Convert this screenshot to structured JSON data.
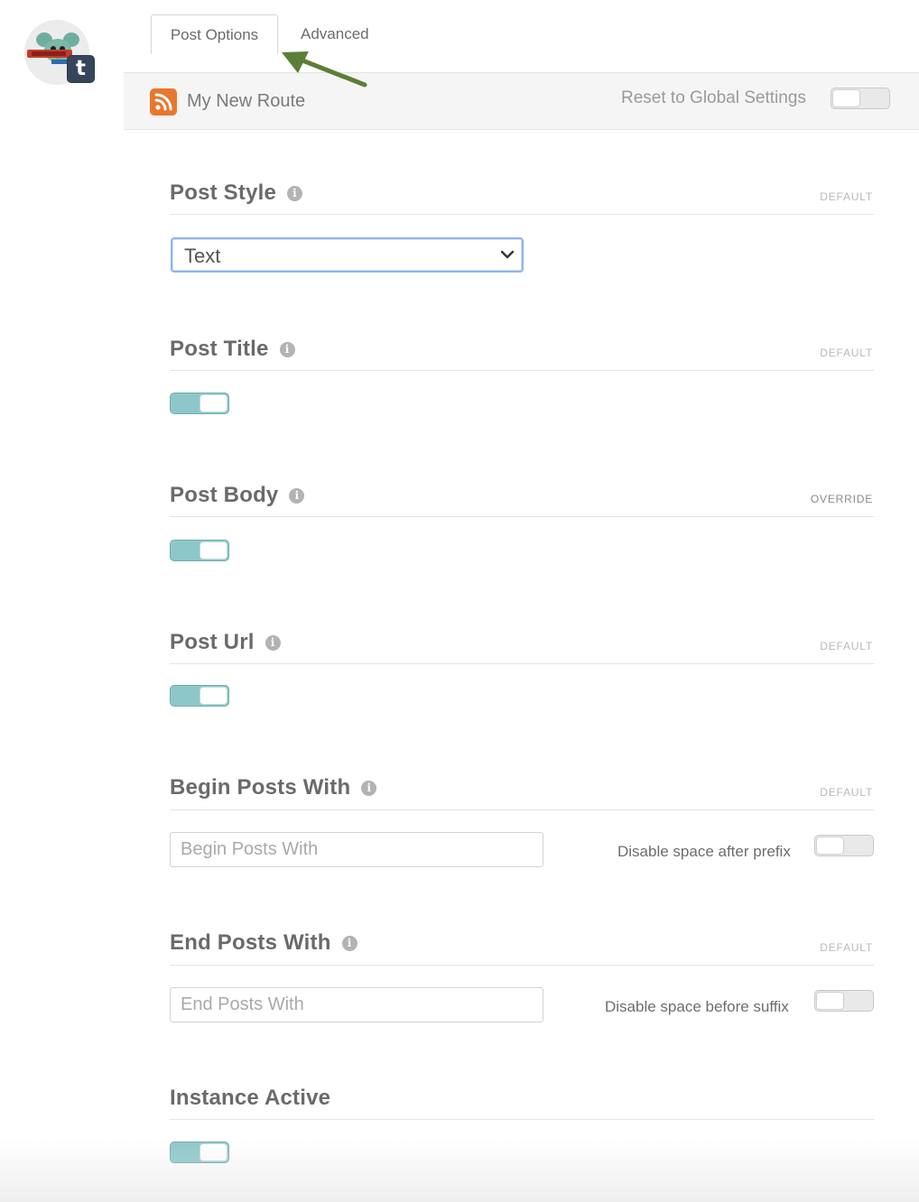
{
  "avatar": {
    "badge_letter": "t",
    "badge_color": "#35465c"
  },
  "tabs": [
    {
      "label": "Post Options",
      "active": true
    },
    {
      "label": "Advanced",
      "active": false
    }
  ],
  "annotation": {
    "arrow_color": "#5b7f36"
  },
  "route": {
    "name": "My New Route",
    "icon": "rss-icon",
    "icon_color": "#e8772e",
    "reset_label": "Reset to Global Settings",
    "reset_on": false
  },
  "accent_color": "#8ec7c9",
  "sections": {
    "post_style": {
      "title": "Post Style",
      "status": "DEFAULT",
      "value": "Text"
    },
    "post_title": {
      "title": "Post Title",
      "status": "DEFAULT",
      "enabled": true
    },
    "post_body": {
      "title": "Post Body",
      "status": "OVERRIDE",
      "enabled": true
    },
    "post_url": {
      "title": "Post Url",
      "status": "DEFAULT",
      "enabled": true
    },
    "begin_posts": {
      "title": "Begin Posts With",
      "status": "DEFAULT",
      "placeholder": "Begin Posts With",
      "value": "",
      "option_label": "Disable space after prefix",
      "option_on": false
    },
    "end_posts": {
      "title": "End Posts With",
      "status": "DEFAULT",
      "placeholder": "End Posts With",
      "value": "",
      "option_label": "Disable space before suffix",
      "option_on": false
    },
    "instance_active": {
      "title": "Instance Active",
      "enabled": true
    }
  }
}
